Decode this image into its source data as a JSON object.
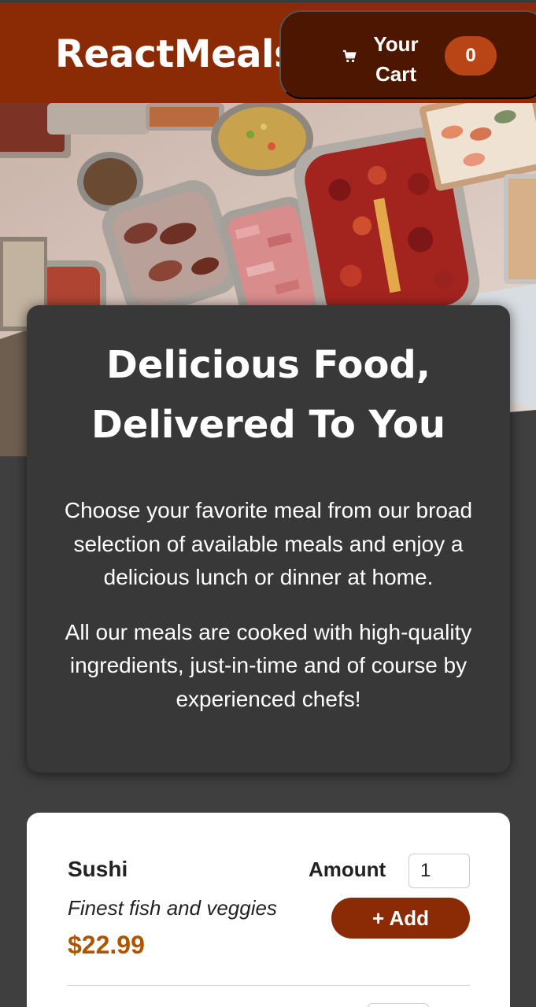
{
  "header": {
    "brand": "ReactMeals",
    "cart_label": "Your Cart",
    "cart_count": "0",
    "cart_icon": "cart-icon"
  },
  "summary": {
    "title": "Delicious Food, Delivered To You",
    "paragraph1": "Choose your favorite meal from our broad selection of available meals and enjoy a delicious lunch or dinner at home.",
    "paragraph2": "All our meals are cooked with high-quality ingredients, just-in-time and of course by experienced chefs!"
  },
  "meals": [
    {
      "name": "Sushi",
      "description": "Finest fish and veggies",
      "price": "$22.99",
      "amount_label": "Amount",
      "amount_value": "1",
      "add_label": "+ Add"
    }
  ],
  "colors": {
    "header_bg": "#8a2b06",
    "cart_bg": "#4d1601",
    "badge_bg": "#b94517",
    "page_bg": "#3f3f3f",
    "card_dark": "#383838",
    "price": "#ad5502"
  }
}
